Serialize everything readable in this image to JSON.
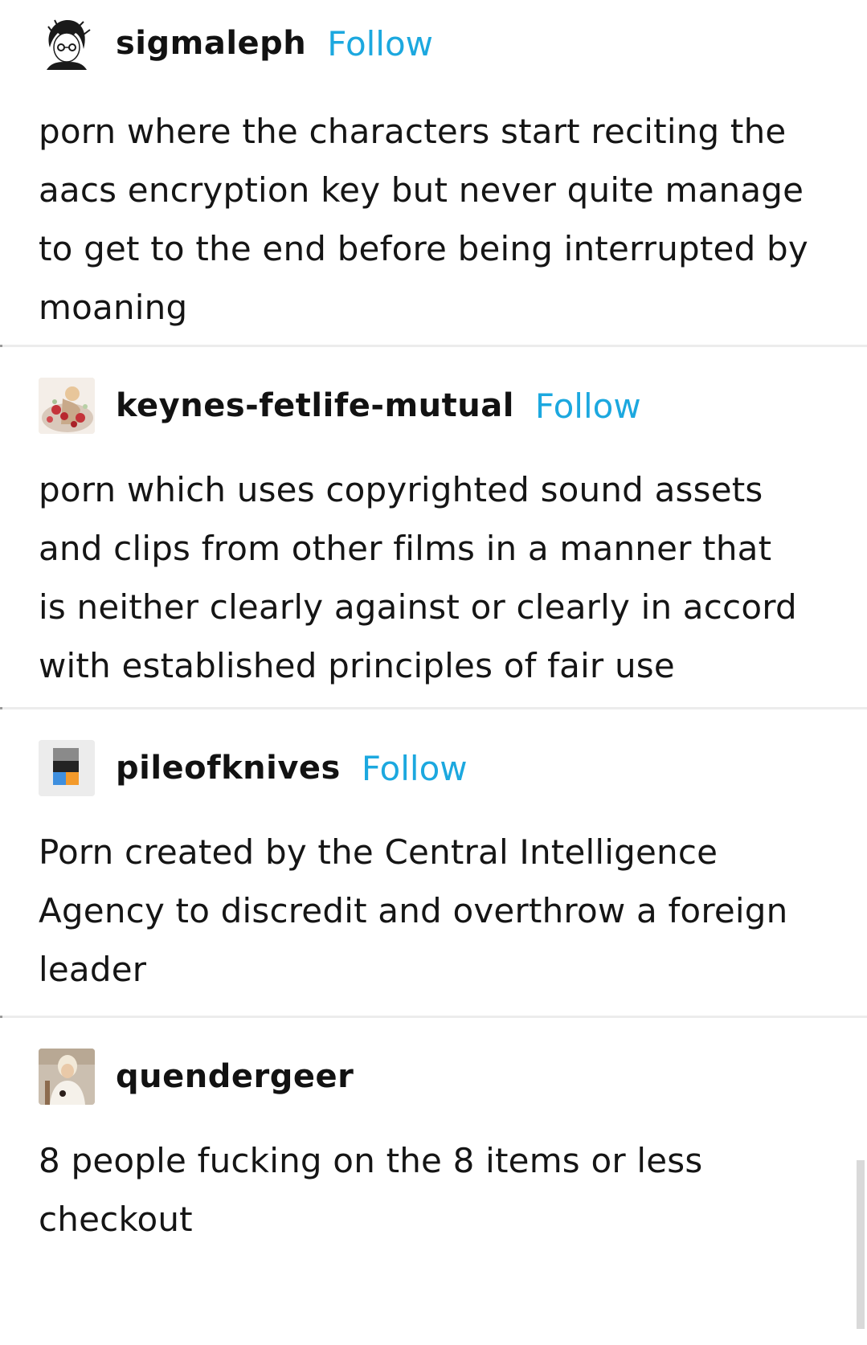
{
  "posts": [
    {
      "username": "sigmaleph",
      "follow_label": "Follow",
      "lines": [
        "porn where the characters start reciting the",
        "aacs encryption key but never quite manage",
        "to get to the end before being interrupted by",
        "moaning"
      ]
    },
    {
      "username": "keynes-fetlife-mutual",
      "follow_label": "Follow",
      "lines": [
        "porn which uses copyrighted sound assets",
        "and clips from other films in a manner that",
        "is neither clearly against or clearly in accord",
        "with established principles of fair use"
      ]
    },
    {
      "username": "pileofknives",
      "follow_label": "Follow",
      "lines": [
        "Porn created by the Central Intelligence",
        "Agency to discredit and overthrow a foreign",
        "leader"
      ]
    },
    {
      "username": "quendergeer",
      "lines": [
        "8 people fucking on the 8 items or less",
        "checkout"
      ]
    }
  ],
  "colors": {
    "follow": "#1ca8df",
    "text": "#151515",
    "divider": "#ececec"
  },
  "icons": {
    "avatar_1": "anime-sketch-avatar-icon",
    "avatar_2": "figure-with-red-flowers-avatar-icon",
    "avatar_3": "pixel-blocks-avatar-icon",
    "avatar_4": "person-portrait-avatar-icon"
  }
}
